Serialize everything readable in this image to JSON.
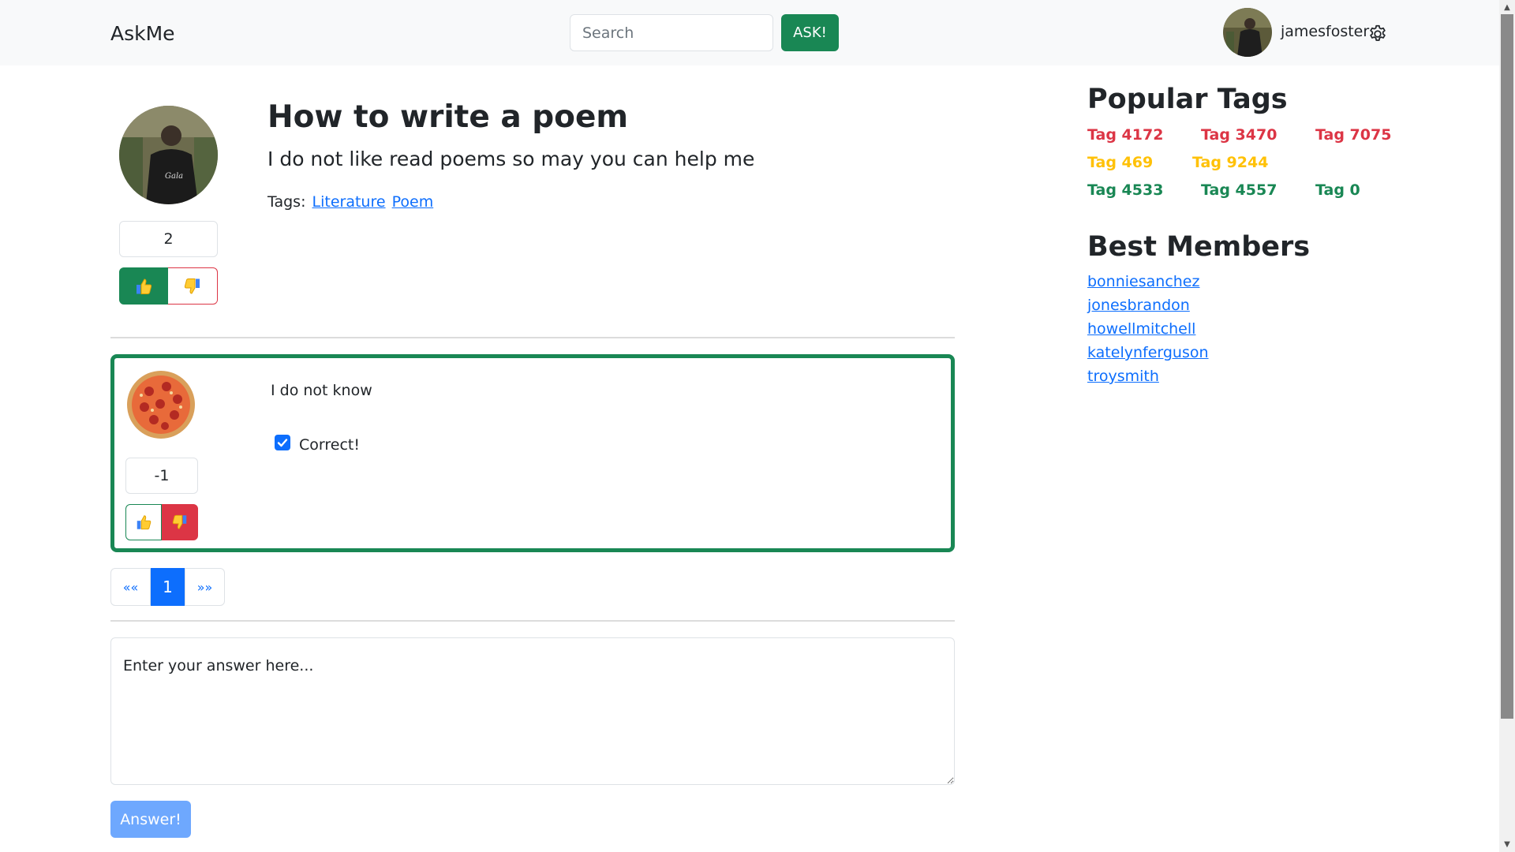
{
  "header": {
    "brand": "AskMe",
    "search_placeholder": "Search",
    "ask_label": "ASK!",
    "username": "jamesfoster"
  },
  "question": {
    "title": "How to write a poem",
    "body": "I do not like read poems so may you can help me",
    "tags_label": "Tags:",
    "tags": [
      "Literature",
      "Poem"
    ],
    "rating": "2"
  },
  "answers": [
    {
      "text": "I do not know",
      "correct_label": "Correct!",
      "correct_checked": true,
      "rating": "-1"
    }
  ],
  "pagination": {
    "first": "««",
    "current": "1",
    "last": "»»"
  },
  "answer_form": {
    "placeholder": "Enter your answer here...",
    "submit_label": "Answer!"
  },
  "sidebar": {
    "popular_tags_heading": "Popular Tags",
    "tags": [
      {
        "label": "Tag 4172",
        "color": "#dc3545"
      },
      {
        "label": "Tag 3470",
        "color": "#dc3545"
      },
      {
        "label": "Tag 7075",
        "color": "#dc3545"
      },
      {
        "label": "Tag 469",
        "color": "#ffc107"
      },
      {
        "label": "Tag 9244",
        "color": "#ffc107"
      },
      {
        "label": "Tag 4533",
        "color": "#198754"
      },
      {
        "label": "Tag 4557",
        "color": "#198754"
      },
      {
        "label": "Tag 0",
        "color": "#198754"
      }
    ],
    "best_members_heading": "Best Members",
    "members": [
      "bonniesanchez",
      "jonesbrandon",
      "howellmitchell",
      "katelynferguson",
      "troysmith"
    ]
  },
  "colors": {
    "success": "#198754",
    "danger": "#dc3545",
    "warning": "#ffc107",
    "primary": "#0d6efd"
  }
}
